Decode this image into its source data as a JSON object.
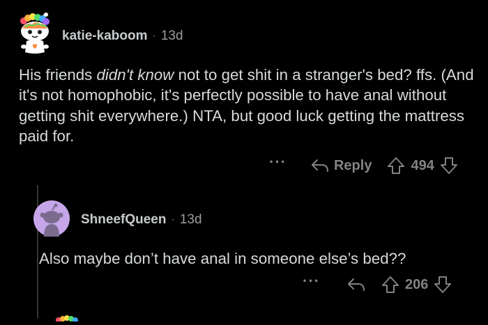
{
  "comments": [
    {
      "username": "katie-kaboom",
      "separator": "·",
      "age": "13d",
      "body_parts": [
        "His friends ",
        "didn't know",
        " not to get shit in a stranger's bed? ffs. (And it's not homophobic, it's perfectly possible to have anal without getting shit everywhere.) NTA, but good luck getting the mattress paid for."
      ],
      "more_label": "···",
      "reply_label": "Reply",
      "score": "494",
      "avatar_icon": "snoo-rainbow-hair-avatar-icon"
    },
    {
      "username": "ShneefQueen",
      "separator": "·",
      "age": "13d",
      "body": "Also maybe don’t have anal in someone else’s bed??",
      "more_label": "···",
      "score": "206",
      "avatar_icon": "default-purple-snoo-avatar-icon"
    }
  ],
  "colors": {
    "background": "#000000",
    "text": "#d7dadc",
    "meta": "#818384",
    "avatar_purple": "#c6a6e8",
    "thread_line": "#343536"
  }
}
